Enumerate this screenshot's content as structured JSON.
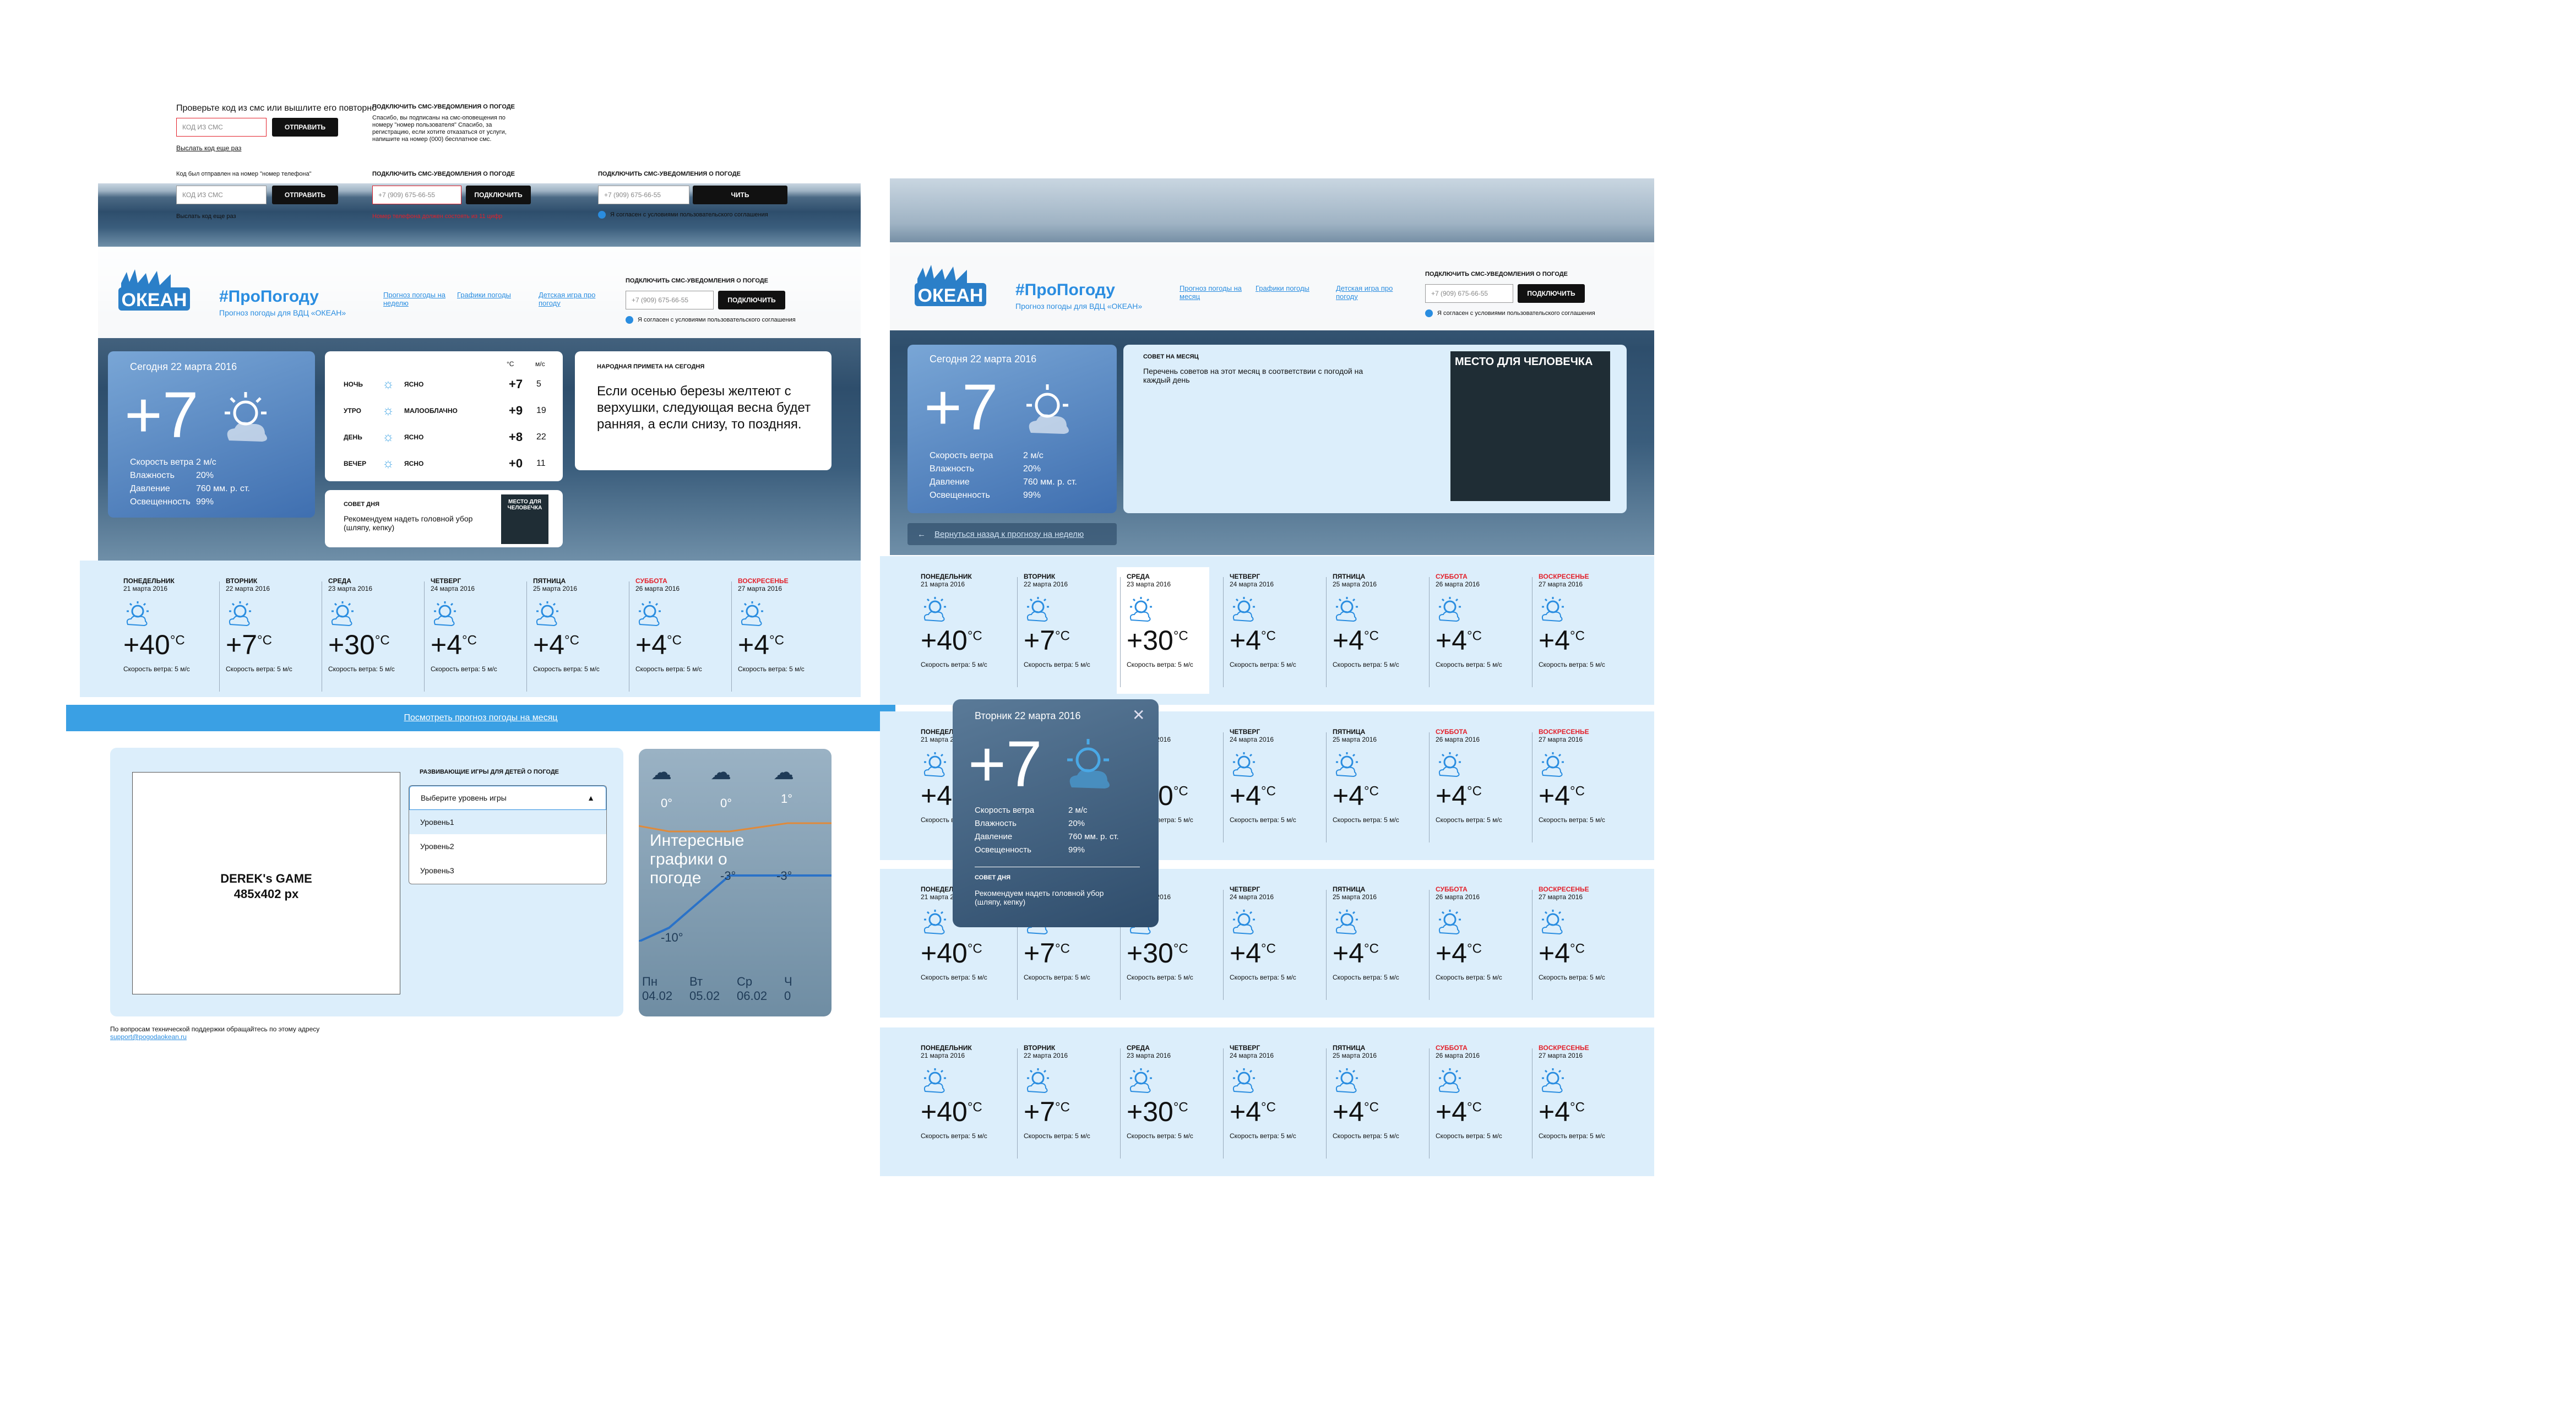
{
  "sms_mock": {
    "error_text": "Проверьте код из смс или вышлите его повторно",
    "code_placeholder": "КОД ИЗ СМС",
    "send_label": "ОТПРАВИТЬ",
    "resend_label": "Выслать код еще раз",
    "sent_text": "Код был отправлен на номер \"номер телефона\"",
    "title": "ПОДКЛЮЧИТЬ СМС-УВЕДОМЛЕНИЯ О ПОГОДЕ",
    "success_text": "Спасибо, вы подписаны на смс-оповещения по номеру \"номер пользователя\" Спасибо, за регистрацию, если хотите отказаться от услуги, напишите на номер (000) бесплатное смс.",
    "phone_placeholder": "+7 (909) 675-66-55",
    "connect_label": "ПОДКЛЮЧИТЬ",
    "connect_short": "ЧИТЬ",
    "phone_error": "Номер телефона должен состоять из 11 цифр",
    "agree_text": "Я согласен с условиями пользовательского соглашения"
  },
  "header": {
    "logo": "ОКЕАН",
    "title": "#ПроПогоду",
    "subtitle": "Прогноз погоды для ВДЦ «ОКЕАН»",
    "nav": [
      "Прогноз погоды на неделю",
      "Графики погоды",
      "Детская игра про погоду"
    ],
    "nav_alt": [
      "Прогноз погоды на месяц",
      "Графики погоды",
      "Детская игра про погоду"
    ],
    "sms_title": "ПОДКЛЮЧИТЬ СМС-УВЕДОМЛЕНИЯ О ПОГОДЕ",
    "phone_placeholder": "+7 (909) 675-66-55",
    "connect_label": "ПОДКЛЮЧИТЬ",
    "agree_text": "Я согласен с условиями пользовательского соглашения"
  },
  "today": {
    "date": "Сегодня 22 марта 2016",
    "temp": "+7",
    "rows": [
      {
        "label": "Скорость ветра",
        "value": "2 м/с"
      },
      {
        "label": "Влажность",
        "value": "20%"
      },
      {
        "label": "Давление",
        "value": "760 мм. р. ст."
      },
      {
        "label": "Освещенность",
        "value": "99%"
      }
    ]
  },
  "dayparts": {
    "h_temp": "°C",
    "h_wind": "м/с",
    "rows": [
      {
        "name": "НОЧЬ",
        "state": "ЯСНО",
        "temp": "+7",
        "wind": "5"
      },
      {
        "name": "УТРО",
        "state": "МАЛООБЛАЧНО",
        "temp": "+9",
        "wind": "19"
      },
      {
        "name": "ДЕНЬ",
        "state": "ЯСНО",
        "temp": "+8",
        "wind": "22"
      },
      {
        "name": "ВЕЧЕР",
        "state": "ЯСНО",
        "temp": "+0",
        "wind": "11"
      }
    ]
  },
  "tip": {
    "title": "СОВЕТ ДНЯ",
    "text": "Рекомендуем надеть головной убор (шляпу, кепку)",
    "placeholder": "МЕСТО ДЛЯ ЧЕЛОВЕЧКА"
  },
  "folk": {
    "title": "НАРОДНАЯ ПРИМЕТА НА СЕГОДНЯ",
    "text": "Если осенью березы желтеют с верхушки, следующая весна будет ранняя, а если снизу, то поздняя."
  },
  "month_tip": {
    "title": "СОВЕТ НА МЕСЯЦ",
    "text": "Перечень советов на этот месяц в соответствии с погодой на каждый день",
    "placeholder": "МЕСТО ДЛЯ ЧЕЛОВЕЧКА"
  },
  "back_link": "Вернуться назад к прогнозу на неделю",
  "week": [
    {
      "name": "ПОНЕДЕЛЬНИК",
      "date": "21 марта 2016",
      "temp": "+40",
      "wind": "Скорость ветра: 5 м/с",
      "weekend": false
    },
    {
      "name": "ВТОРНИК",
      "date": "22 марта 2016",
      "temp": "+7",
      "wind": "Скорость ветра: 5 м/с",
      "weekend": false
    },
    {
      "name": "СРЕДА",
      "date": "23 марта 2016",
      "temp": "+30",
      "wind": "Скорость ветра: 5 м/с",
      "weekend": false
    },
    {
      "name": "ЧЕТВЕРГ",
      "date": "24 марта 2016",
      "temp": "+4",
      "wind": "Скорость ветра: 5 м/с",
      "weekend": false
    },
    {
      "name": "ПЯТНИЦА",
      "date": "25 марта 2016",
      "temp": "+4",
      "wind": "Скорость ветра: 5 м/с",
      "weekend": false
    },
    {
      "name": "СУББОТА",
      "date": "26 марта 2016",
      "temp": "+4",
      "wind": "Скорость ветра: 5 м/с",
      "weekend": true
    },
    {
      "name": "ВОСКРЕСЕНЬЕ",
      "date": "27 марта 2016",
      "temp": "+4",
      "wind": "Скорость ветра: 5 м/с",
      "weekend": true
    }
  ],
  "unit": "°C",
  "month_link": "Посмотреть прогноз погоды на месяц",
  "games": {
    "title": "РАЗВИВАЮЩИЕ ИГРЫ ДЛЯ ДЕТЕЙ О ПОГОДЕ",
    "game_label": "DEREK's GAME",
    "game_size": "485x402 px",
    "select_label": "Выберите уровень игры",
    "options": [
      "Уровень1",
      "Уровень2",
      "Уровень3"
    ]
  },
  "charts_card": {
    "title": "Интересные графики о погоде",
    "temps_top": [
      "0°",
      "0°",
      "1°"
    ],
    "temps_low": [
      "-10°",
      "-3°",
      "-3°"
    ],
    "days": [
      {
        "d": "Пн",
        "dt": "04.02"
      },
      {
        "d": "Вт",
        "dt": "05.02"
      },
      {
        "d": "Ср",
        "dt": "06.02"
      },
      {
        "d": "Ч",
        "dt": "0"
      }
    ]
  },
  "support": {
    "text": "По вопросам технической поддержки обращайтесь по этому адресу",
    "email": "support@pogodaokean.ru"
  },
  "popup": {
    "date": "Вторник 22 марта 2016",
    "temp": "+7",
    "rows": [
      {
        "label": "Скорость ветра",
        "value": "2 м/с"
      },
      {
        "label": "Влажность",
        "value": "20%"
      },
      {
        "label": "Давление",
        "value": "760 мм. р. ст."
      },
      {
        "label": "Освещенность",
        "value": "99%"
      }
    ],
    "tip_title": "СОВЕТ ДНЯ",
    "tip_text": "Рекомендуем надеть головной убор (шляпу, кепку)"
  },
  "colors": {
    "accent": "#2a8de0",
    "week_bg": "#dceefb",
    "weekend": "#e3202a"
  }
}
